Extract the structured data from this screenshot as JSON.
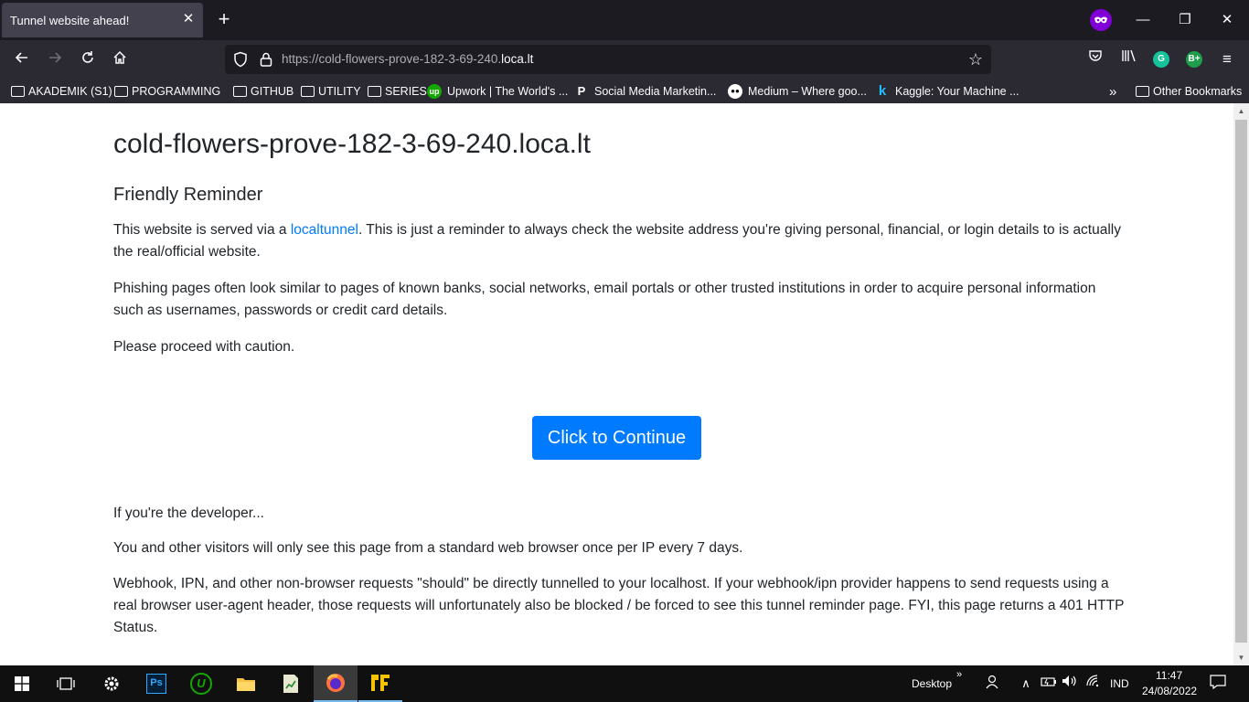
{
  "browser": {
    "tab": {
      "title": "Tunnel website ahead!"
    },
    "url": {
      "prefix": "https://cold-flowers-prove-182-3-69-240.",
      "host": "loca.lt"
    },
    "bookmarks": [
      {
        "label": "AKADEMIK (S1)",
        "type": "folder"
      },
      {
        "label": "PROGRAMMING",
        "type": "folder"
      },
      {
        "label": "GITHUB",
        "type": "folder"
      },
      {
        "label": "UTILITY",
        "type": "folder"
      },
      {
        "label": "SERIES",
        "type": "folder"
      },
      {
        "label": "Upwork | The World's ...",
        "type": "link",
        "icon": "upwork-icon"
      },
      {
        "label": "Social Media Marketin...",
        "type": "link",
        "icon": "p-icon"
      },
      {
        "label": "Medium – Where goo...",
        "type": "link",
        "icon": "medium-icon"
      },
      {
        "label": "Kaggle: Your Machine ...",
        "type": "link",
        "icon": "kaggle-icon"
      }
    ],
    "other_bookmarks": "Other Bookmarks",
    "extensions": {
      "grammarly": "G",
      "bplus": "B+"
    }
  },
  "page": {
    "title": "cold-flowers-prove-182-3-69-240.loca.lt",
    "subtitle": "Friendly Reminder",
    "p1_before": "This website is served via a ",
    "p1_link": "localtunnel",
    "p1_after": ". This is just a reminder to always check the website address you're giving personal, financial, or login details to is actually the real/official website.",
    "p2": "Phishing pages often look similar to pages of known banks, social networks, email portals or other trusted institutions in order to acquire personal information such as usernames, passwords or credit card details.",
    "p3": "Please proceed with caution.",
    "button": "Click to Continue",
    "dev_heading": "If you're the developer...",
    "dev_p1": "You and other visitors will only see this page from a standard web browser once per IP every 7 days.",
    "dev_p2": "Webhook, IPN, and other non-browser requests \"should\" be directly tunnelled to your localhost. If your webhook/ipn provider happens to send requests using a real browser user-agent header, those requests will unfortunately also be blocked / be forced to see this tunnel reminder page. FYI, this page returns a 401 HTTP Status."
  },
  "taskbar": {
    "desktop_label": "Desktop",
    "language": "IND",
    "time": "11:47",
    "date": "24/08/2022",
    "ps_label": "Ps",
    "upwork_label": "U"
  },
  "colors": {
    "accent": "#007bff",
    "private": "#8000d7",
    "grammarly": "#15c39a",
    "bplus": "#1e9e4a"
  }
}
